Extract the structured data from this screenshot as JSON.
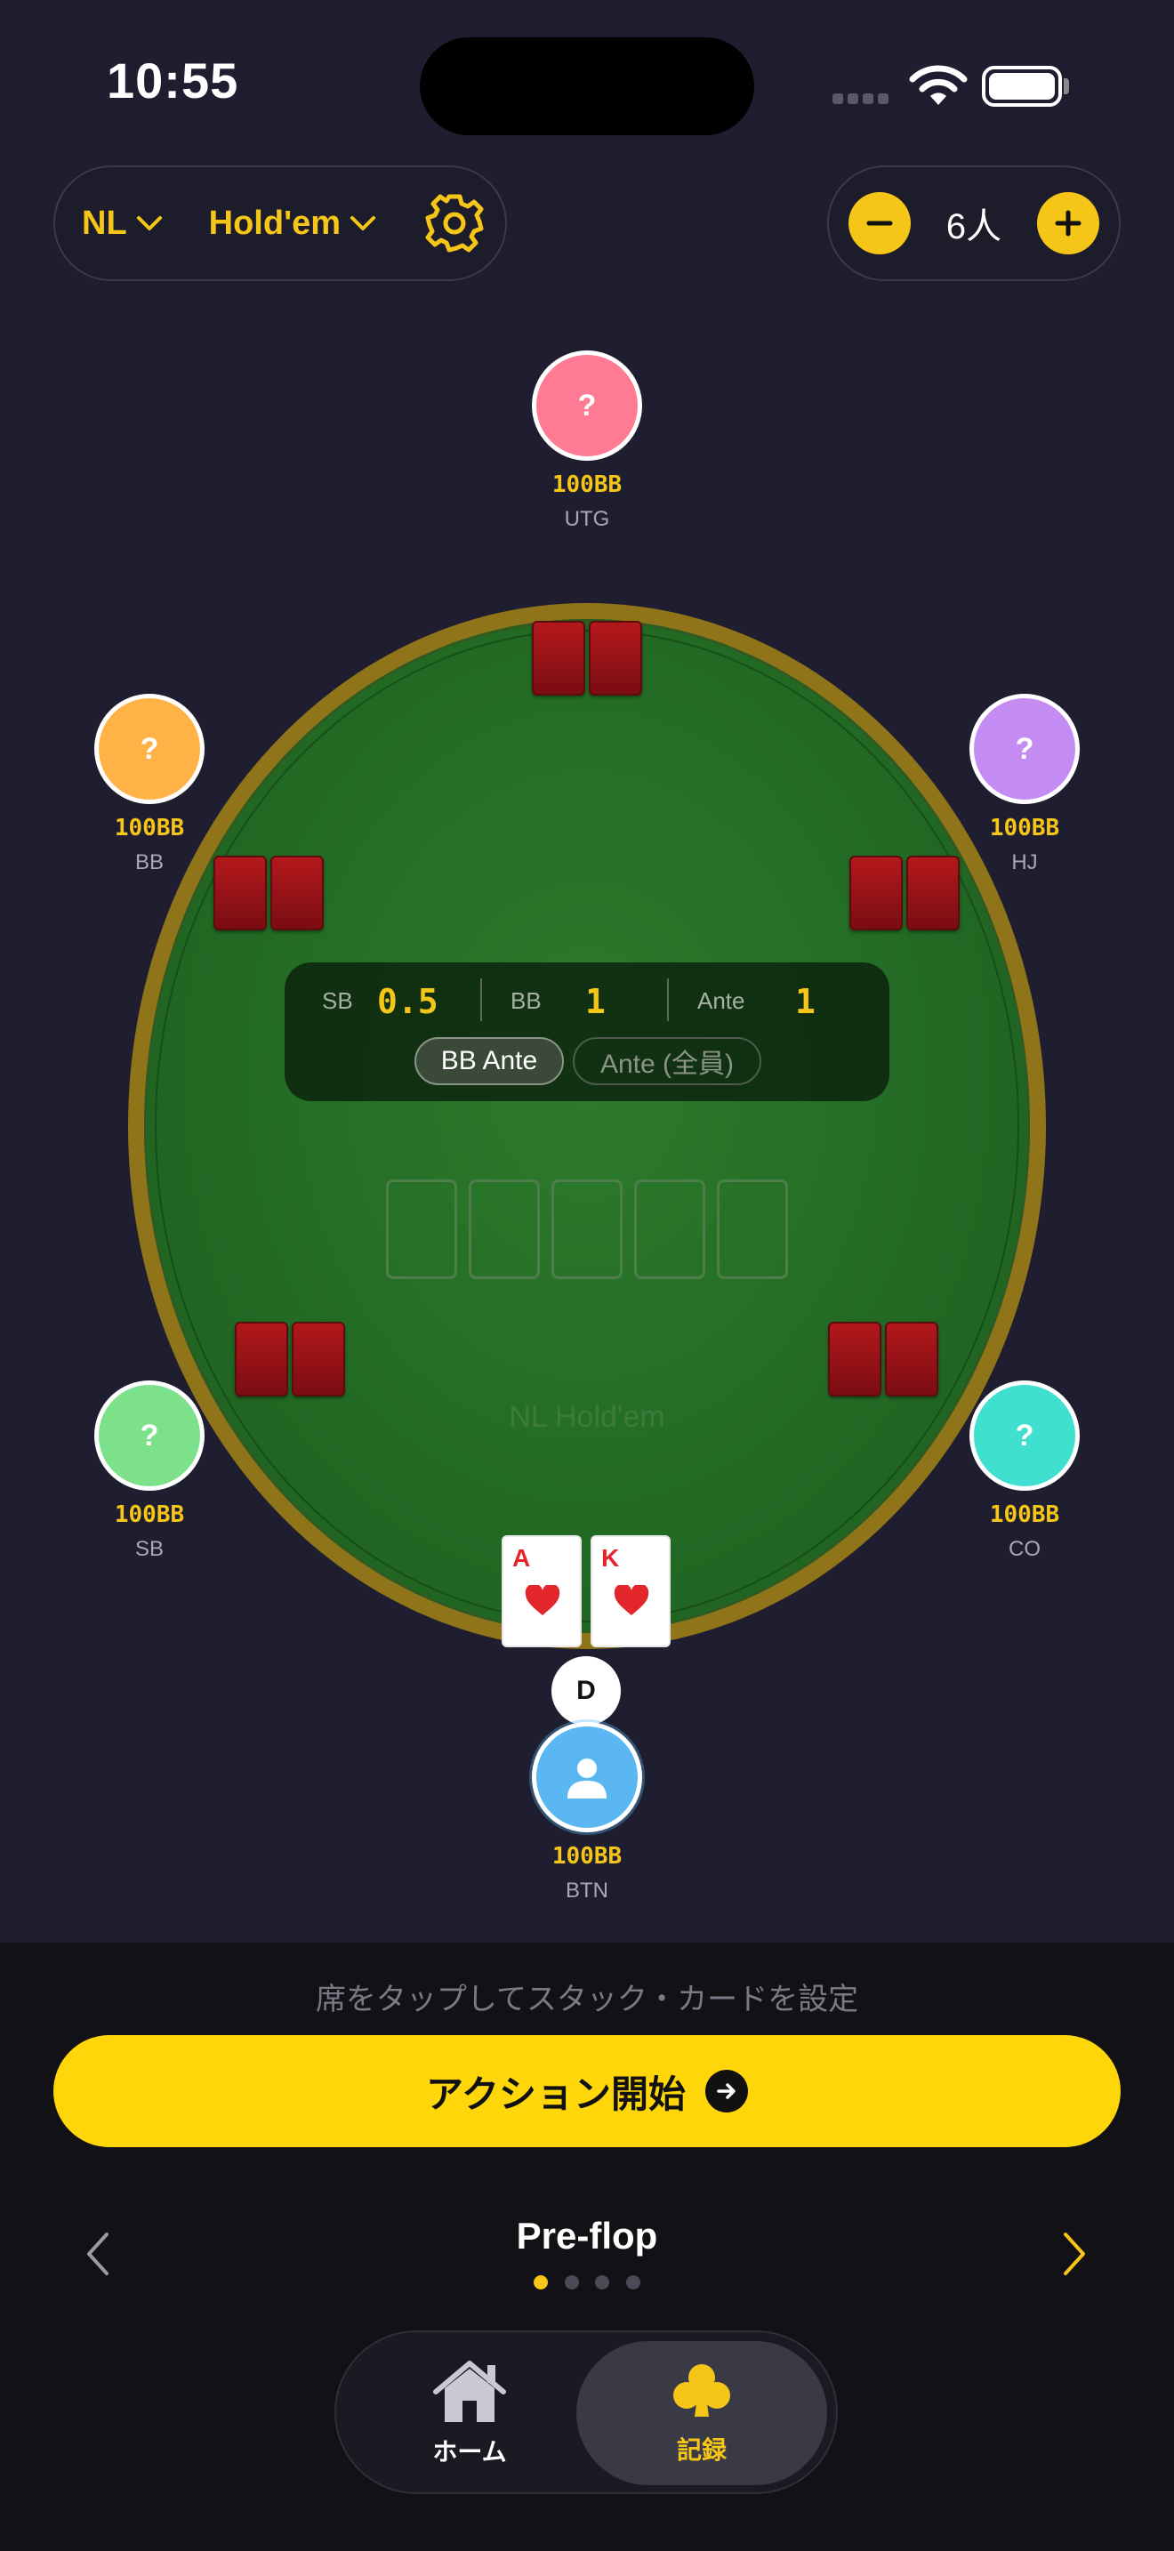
{
  "status_bar": {
    "time": "10:55"
  },
  "header": {
    "game_limit": "NL",
    "game_type": "Hold'em",
    "player_count": "6人"
  },
  "seats": [
    {
      "id": "utg",
      "avatar": "?",
      "stack": "100BB",
      "position": "UTG",
      "color": "#ff7a93"
    },
    {
      "id": "bb",
      "avatar": "?",
      "stack": "100BB",
      "position": "BB",
      "color": "#ffb347"
    },
    {
      "id": "hj",
      "avatar": "?",
      "stack": "100BB",
      "position": "HJ",
      "color": "#c48cf2"
    },
    {
      "id": "sb",
      "avatar": "?",
      "stack": "100BB",
      "position": "SB",
      "color": "#7de08a"
    },
    {
      "id": "co",
      "avatar": "?",
      "stack": "100BB",
      "position": "CO",
      "color": "#40e0d0"
    },
    {
      "id": "btn",
      "avatar": "person-icon",
      "stack": "100BB",
      "position": "BTN",
      "color": "#5ab7f2"
    }
  ],
  "blinds": {
    "sb_label": "SB",
    "sb_value": "0.5",
    "bb_label": "BB",
    "bb_value": "1",
    "ante_label": "Ante",
    "ante_value": "1",
    "ante_options": [
      "BB Ante",
      "Ante (全員)"
    ],
    "selected_ante_option": "BB Ante"
  },
  "table": {
    "name": "NL Hold'em",
    "felt_color": "#236b25",
    "rail_color": "#8f7419"
  },
  "hero": {
    "cards": [
      {
        "rank": "A",
        "suit": "heart"
      },
      {
        "rank": "K",
        "suit": "heart"
      }
    ],
    "dealer_button": "D"
  },
  "bottom": {
    "hint": "席をタップしてスタック・カードを設定",
    "start_button": "アクション開始",
    "phase": "Pre-flop",
    "phase_index": 0,
    "phase_count": 4
  },
  "tabbar": {
    "tabs": [
      {
        "label": "ホーム",
        "icon": "home-icon",
        "active": false
      },
      {
        "label": "記録",
        "icon": "club-icon",
        "active": true
      }
    ]
  },
  "colors": {
    "accent": "#f5c518",
    "button": "#ffd60a",
    "card_back": "#b3181c"
  }
}
